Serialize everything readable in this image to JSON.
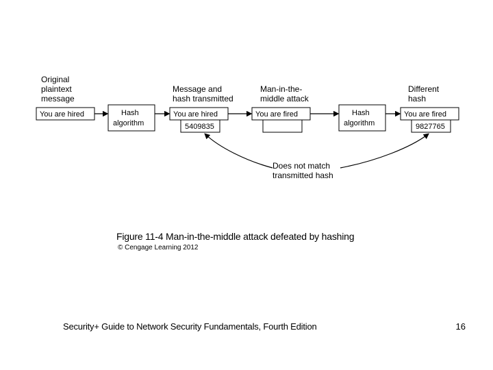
{
  "diagram": {
    "labels": {
      "original": {
        "line1": "Original",
        "line2": "plaintext",
        "line3": "message"
      },
      "msg_hash": {
        "line1": "Message and",
        "line2": "hash transmitted"
      },
      "mitm": {
        "line1": "Man-in-the-",
        "line2": "middle attack"
      },
      "diff_hash": {
        "line1": "Different",
        "line2": "hash"
      },
      "no_match": {
        "line1": "Does not match",
        "line2": "transmitted hash"
      }
    },
    "boxes": {
      "b1": "You are hired",
      "b2a": "Hash",
      "b2b": "algorithm",
      "b3": "You are hired",
      "b3h": "5409835",
      "b4": "You are fired",
      "b5a": "Hash",
      "b5b": "algorithm",
      "b6": "You are fired",
      "b6h": "9827765"
    }
  },
  "caption": "Figure 11-4 Man-in-the-middle attack defeated by hashing",
  "copyright": "© Cengage Learning 2012",
  "footer": "Security+ Guide to Network Security Fundamentals, Fourth Edition",
  "page": "16"
}
